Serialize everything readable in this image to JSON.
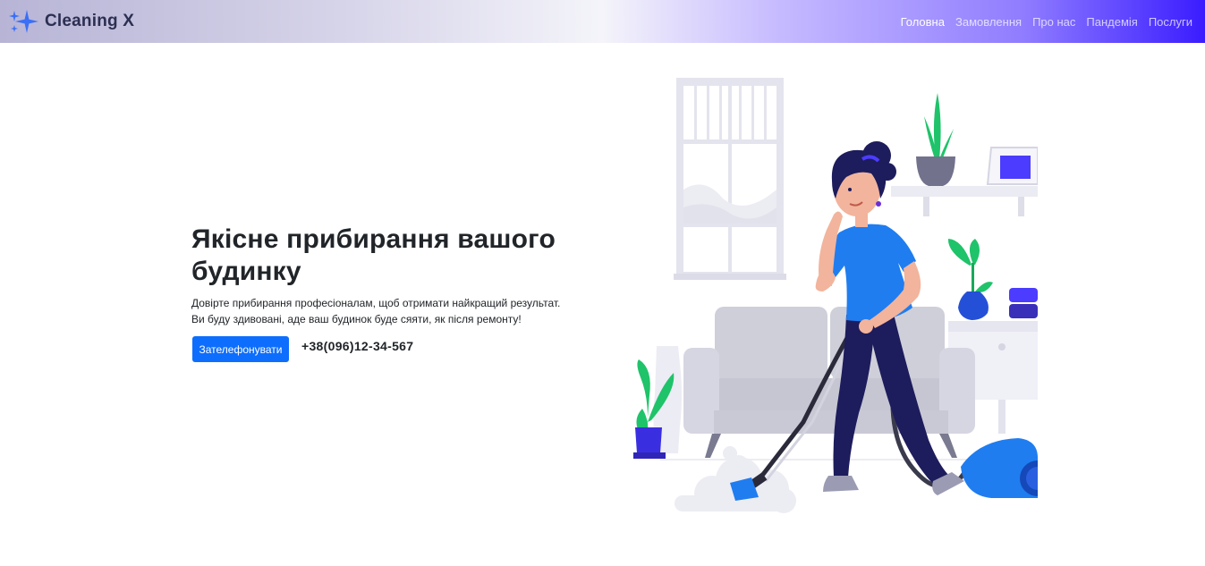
{
  "brand": {
    "name": "Cleaning X",
    "icon": "sparkles-icon"
  },
  "nav": {
    "items": [
      {
        "label": "Головна",
        "active": true
      },
      {
        "label": "Замовлення",
        "active": false
      },
      {
        "label": "Про нас",
        "active": false
      },
      {
        "label": "Пандемія",
        "active": false
      },
      {
        "label": "Послуги",
        "active": false
      }
    ]
  },
  "hero": {
    "title": "Якісне прибирання вашого будинку",
    "text_line1": "Довірте прибирання професіоналам, щоб отримати найкращий результат.",
    "text_line2": "Ви буду здивовані, аде ваш будинок буде сяяти, як після ремонту!",
    "call_button": "Зателефонувати",
    "phone": "+38(096)12-34-567"
  },
  "colors": {
    "primary": "#0d6efd",
    "accent": "#4b3cff",
    "shirt": "#1f7df0",
    "plant": "#1fc36a",
    "pants": "#1d1c5c"
  }
}
